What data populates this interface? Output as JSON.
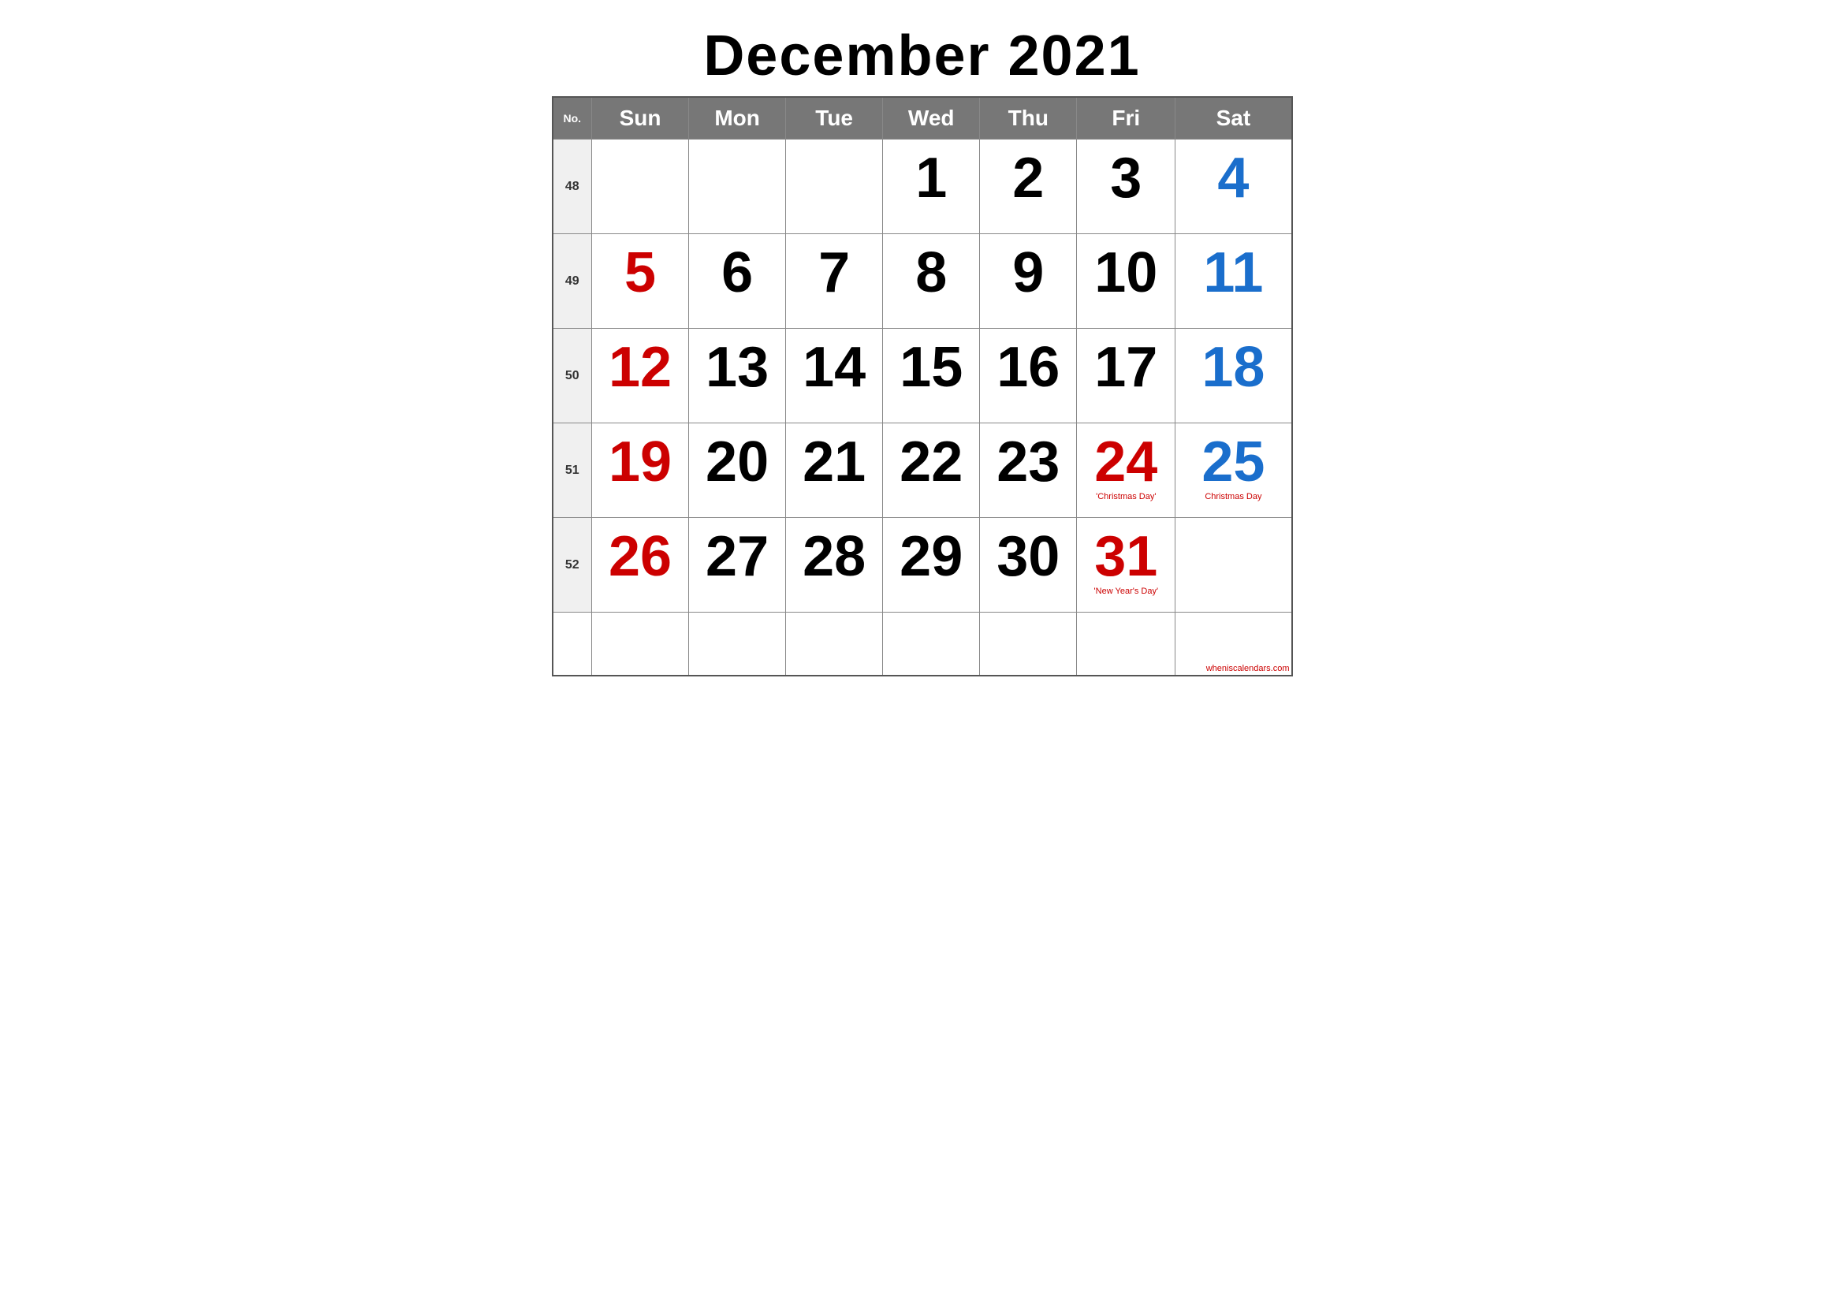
{
  "title": "December 2021",
  "header": {
    "no_label": "No.",
    "days": [
      "Sun",
      "Mon",
      "Tue",
      "Wed",
      "Thu",
      "Fri",
      "Sat"
    ]
  },
  "weeks": [
    {
      "week_no": "48",
      "days": [
        {
          "date": "",
          "color": ""
        },
        {
          "date": "",
          "color": ""
        },
        {
          "date": "",
          "color": ""
        },
        {
          "date": "1",
          "color": "black"
        },
        {
          "date": "2",
          "color": "black"
        },
        {
          "date": "3",
          "color": "black"
        },
        {
          "date": "4",
          "color": "blue"
        }
      ]
    },
    {
      "week_no": "49",
      "days": [
        {
          "date": "5",
          "color": "red"
        },
        {
          "date": "6",
          "color": "black"
        },
        {
          "date": "7",
          "color": "black"
        },
        {
          "date": "8",
          "color": "black"
        },
        {
          "date": "9",
          "color": "black"
        },
        {
          "date": "10",
          "color": "black"
        },
        {
          "date": "11",
          "color": "blue"
        }
      ]
    },
    {
      "week_no": "50",
      "days": [
        {
          "date": "12",
          "color": "red"
        },
        {
          "date": "13",
          "color": "black"
        },
        {
          "date": "14",
          "color": "black"
        },
        {
          "date": "15",
          "color": "black"
        },
        {
          "date": "16",
          "color": "black"
        },
        {
          "date": "17",
          "color": "black"
        },
        {
          "date": "18",
          "color": "blue"
        }
      ]
    },
    {
      "week_no": "51",
      "days": [
        {
          "date": "19",
          "color": "red"
        },
        {
          "date": "20",
          "color": "black"
        },
        {
          "date": "21",
          "color": "black"
        },
        {
          "date": "22",
          "color": "black"
        },
        {
          "date": "23",
          "color": "black"
        },
        {
          "date": "24",
          "color": "red",
          "holiday": "'Christmas Day'"
        },
        {
          "date": "25",
          "color": "blue",
          "holiday": "Christmas Day"
        }
      ]
    },
    {
      "week_no": "52",
      "days": [
        {
          "date": "26",
          "color": "red"
        },
        {
          "date": "27",
          "color": "black"
        },
        {
          "date": "28",
          "color": "black"
        },
        {
          "date": "29",
          "color": "black"
        },
        {
          "date": "30",
          "color": "black"
        },
        {
          "date": "31",
          "color": "red",
          "holiday": "'New Year's Day'"
        },
        {
          "date": "",
          "color": ""
        }
      ]
    }
  ],
  "watermark": "wheniscalendars.com"
}
